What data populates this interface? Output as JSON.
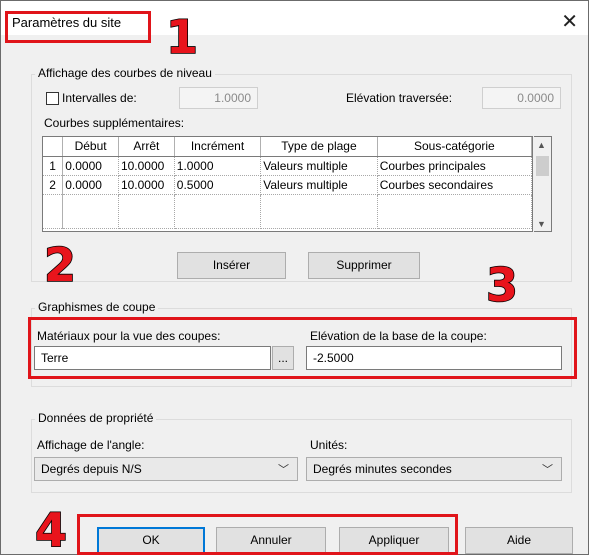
{
  "window": {
    "title": "Paramètres du site",
    "close_icon": "close-icon"
  },
  "contours": {
    "group_label": "Affichage des courbes de niveau",
    "intervals_label": "Intervalles de:",
    "intervals_checked": false,
    "intervals_value": "1.0000",
    "pass_through_label": "Elévation traversée:",
    "pass_through_value": "0.0000",
    "additional_label": "Courbes supplémentaires:",
    "columns": [
      "",
      "Début",
      "Arrêt",
      "Incrément",
      "Type de plage",
      "Sous-catégorie"
    ],
    "rows": [
      {
        "n": "1",
        "start": "0.0000",
        "stop": "10.0000",
        "inc": "1.0000",
        "type": "Valeurs multiple",
        "sub": "Courbes principales"
      },
      {
        "n": "2",
        "start": "0.0000",
        "stop": "10.0000",
        "inc": "0.5000",
        "type": "Valeurs multiple",
        "sub": "Courbes secondaires"
      }
    ],
    "insert_label": "Insérer",
    "delete_label": "Supprimer"
  },
  "section": {
    "group_label": "Graphismes de coupe",
    "material_label": "Matériaux pour la vue des coupes:",
    "material_value": "Terre",
    "browse_label": "...",
    "elevation_label": "Elévation de la base de la coupe:",
    "elevation_value": "-2.5000"
  },
  "property": {
    "group_label": "Données de propriété",
    "angle_label": "Affichage de l'angle:",
    "angle_value": "Degrés depuis N/S",
    "units_label": "Unités:",
    "units_value": "Degrés minutes secondes"
  },
  "buttons": {
    "ok": "OK",
    "cancel": "Annuler",
    "apply": "Appliquer",
    "help": "Aide"
  },
  "annotations": {
    "n1": "1",
    "n2": "2",
    "n3": "3",
    "n4": "4",
    "color": "#e8141c"
  }
}
